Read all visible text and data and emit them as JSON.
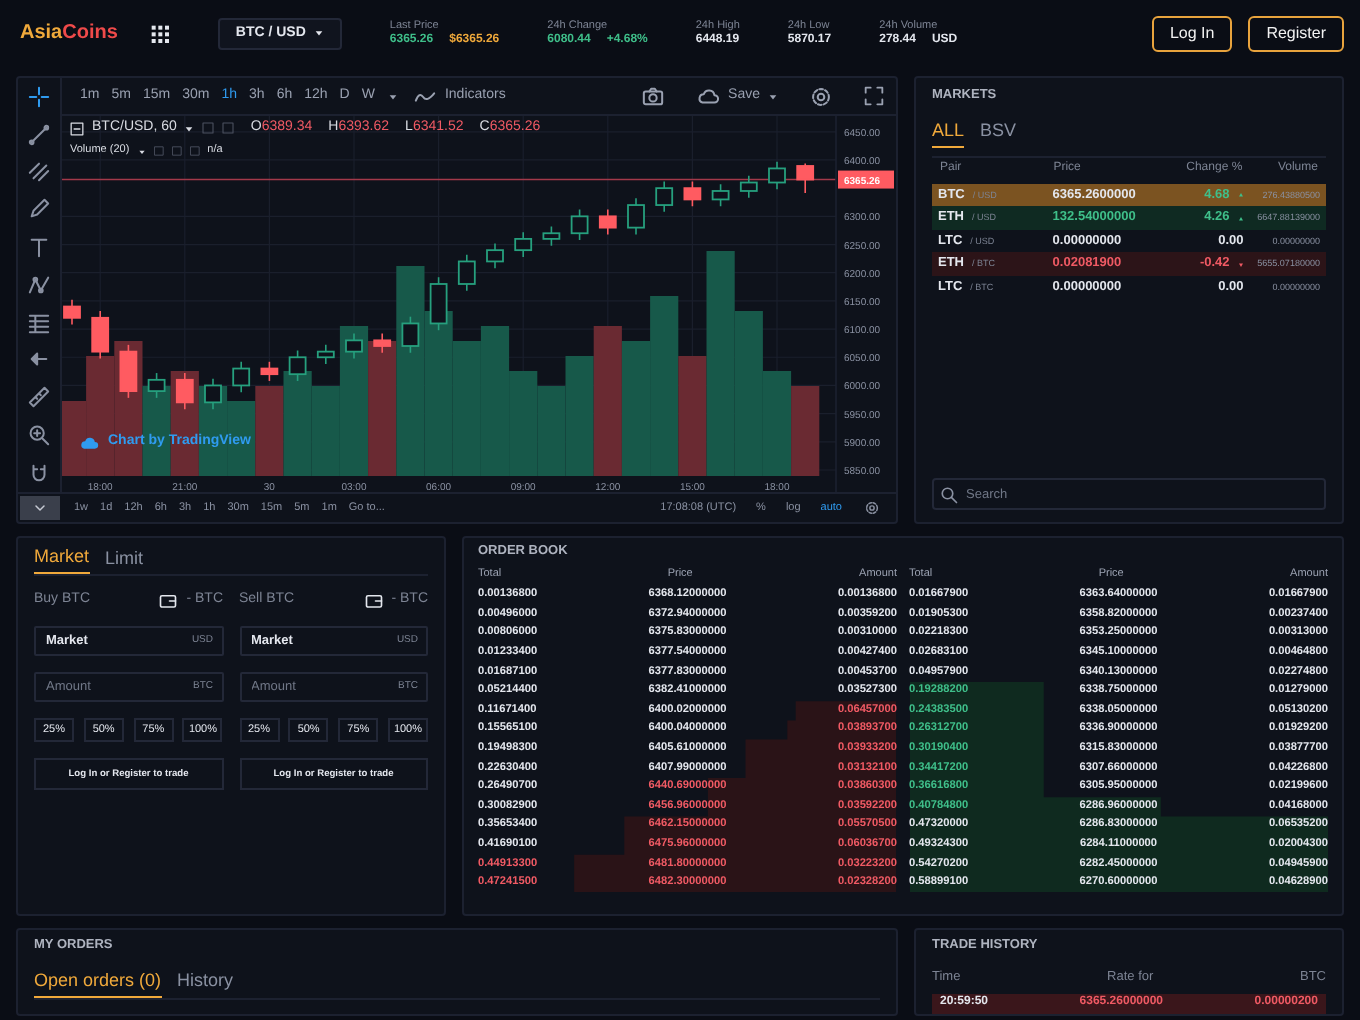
{
  "header": {
    "logo": [
      "Asia",
      "Coins"
    ],
    "pair_selector": "BTC / USD",
    "stats": [
      {
        "label": "Last Price",
        "values": [
          {
            "text": "6365.26",
            "color": "#3fbf8a"
          },
          {
            "text": "$6365.26",
            "color": "#f0a93b"
          }
        ]
      },
      {
        "label": "24h Change",
        "values": [
          {
            "text": "6080.44",
            "color": "#3fbf8a"
          },
          {
            "text": "+4.68%",
            "color": "#3fbf8a"
          }
        ]
      },
      {
        "label": "24h High",
        "values": [
          {
            "text": "6448.19"
          }
        ]
      },
      {
        "label": "24h Low",
        "values": [
          {
            "text": "5870.17"
          }
        ]
      },
      {
        "label": "24h Volume",
        "values": [
          {
            "text": "278.44"
          },
          {
            "text": "USD"
          }
        ]
      }
    ],
    "buttons": [
      "Log In",
      "Register"
    ]
  },
  "chart": {
    "intervals": [
      {
        "label": "1m",
        "selected": false
      },
      {
        "label": "5m",
        "selected": false
      },
      {
        "label": "15m",
        "selected": false
      },
      {
        "label": "30m",
        "selected": false
      },
      {
        "label": "1h",
        "selected": true
      },
      {
        "label": "3h",
        "selected": false
      },
      {
        "label": "6h",
        "selected": false
      },
      {
        "label": "12h",
        "selected": false
      },
      {
        "label": "D",
        "selected": false
      },
      {
        "label": "W",
        "selected": false
      }
    ],
    "indicators": "Indicators",
    "save": "Save",
    "legend": {
      "symbol": "BTC/USD, 60",
      "ohlc": [
        {
          "key": "O",
          "value": "6389.34"
        },
        {
          "key": "H",
          "value": "6393.62"
        },
        {
          "key": "L",
          "value": "6341.52"
        },
        {
          "key": "C",
          "value": "6365.26"
        }
      ],
      "volume": "Volume (20)",
      "volume_value": "n/a"
    },
    "chart_data": {
      "type": "candlestick",
      "categories": [
        null,
        "18:00",
        null,
        null,
        "21:00",
        null,
        null,
        "30",
        null,
        null,
        "03:00",
        null,
        null,
        "06:00",
        null,
        null,
        "09:00",
        null,
        null,
        "12:00",
        null,
        null,
        "15:00",
        null,
        null,
        "18:00",
        null
      ],
      "ohlc": [
        [
          6140,
          6152,
          6108,
          6120
        ],
        [
          6120,
          6132,
          6048,
          6060
        ],
        [
          6060,
          6072,
          5978,
          5990
        ],
        [
          5990,
          6022,
          5978,
          6010
        ],
        [
          6010,
          6022,
          5958,
          5970
        ],
        [
          5970,
          6012,
          5958,
          6000
        ],
        [
          6000,
          6042,
          5988,
          6030
        ],
        [
          6030,
          6042,
          6008,
          6020
        ],
        [
          6020,
          6062,
          6008,
          6050
        ],
        [
          6050,
          6072,
          6038,
          6060
        ],
        [
          6060,
          6092,
          6048,
          6080
        ],
        [
          6080,
          6092,
          6058,
          6070
        ],
        [
          6070,
          6122,
          6058,
          6110
        ],
        [
          6110,
          6192,
          6098,
          6180
        ],
        [
          6180,
          6232,
          6168,
          6220
        ],
        [
          6220,
          6252,
          6208,
          6240
        ],
        [
          6240,
          6272,
          6228,
          6260
        ],
        [
          6260,
          6282,
          6248,
          6270
        ],
        [
          6270,
          6312,
          6258,
          6300
        ],
        [
          6300,
          6312,
          6268,
          6280
        ],
        [
          6280,
          6332,
          6268,
          6320
        ],
        [
          6320,
          6362,
          6308,
          6350
        ],
        [
          6350,
          6362,
          6318,
          6330
        ],
        [
          6330,
          6357,
          6318,
          6345
        ],
        [
          6345,
          6372,
          6333,
          6360
        ],
        [
          6360,
          6397,
          6348,
          6385
        ],
        [
          6389.34,
          6393.62,
          6341.52,
          6365.26
        ]
      ],
      "ylim": [
        5811,
        6478
      ],
      "grid": true,
      "yticks": [
        {
          "value": 6450,
          "label": "6450.00"
        },
        {
          "value": 6400,
          "label": "6400.00"
        },
        {
          "value": 6300,
          "label": "6300.00"
        },
        {
          "value": 6250,
          "label": "6250.00"
        },
        {
          "value": 6200,
          "label": "6200.00"
        },
        {
          "value": 6150,
          "label": "6150.00"
        },
        {
          "value": 6100,
          "label": "6100.00"
        },
        {
          "value": 6050,
          "label": "6050.00"
        },
        {
          "value": 6000,
          "label": "6000.00"
        },
        {
          "value": 5950,
          "label": "5950.00"
        },
        {
          "value": 5900,
          "label": "5900.00"
        },
        {
          "value": 5850,
          "label": "5850.00"
        }
      ]
    },
    "price_tag": "6365.26",
    "attribution": "Chart by TradingView",
    "ranges": [
      "1w",
      "1d",
      "12h",
      "6h",
      "3h",
      "1h",
      "30m",
      "15m",
      "5m",
      "1m"
    ],
    "goto": "Go to...",
    "clock": "17:08:08 (UTC)",
    "scale_options": [
      {
        "label": "%",
        "selected": false
      },
      {
        "label": "log",
        "selected": false
      },
      {
        "label": "auto",
        "selected": true
      }
    ]
  },
  "markets": {
    "title": "MARKETS",
    "tabs": [
      {
        "label": "ALL",
        "selected": true
      },
      {
        "label": "BSV",
        "selected": false
      }
    ],
    "columns": [
      "Pair",
      "Price",
      "Change %",
      "Volume"
    ],
    "rows": [
      {
        "base": "BTC",
        "quote": "/ USD",
        "price": "6365.2600000",
        "change": "4.68",
        "volume": "276.43880500",
        "kind": "up",
        "selected": true
      },
      {
        "base": "ETH",
        "quote": "/ USD",
        "price": "132.54000000",
        "change": "4.26",
        "volume": "6647.88139000",
        "kind": "up",
        "selected": false
      },
      {
        "base": "LTC",
        "quote": "/ USD",
        "price": "0.00000000",
        "change": "0.00",
        "volume": "0.00000000",
        "kind": "flat",
        "selected": false
      },
      {
        "base": "ETH",
        "quote": "/ BTC",
        "price": "0.02081900",
        "change": "-0.42",
        "volume": "5655.07180000",
        "kind": "down",
        "selected": false
      },
      {
        "base": "LTC",
        "quote": "/ BTC",
        "price": "0.00000000",
        "change": "0.00",
        "volume": "0.00000000",
        "kind": "flat",
        "selected": false
      }
    ],
    "search": {
      "placeholder": "Search"
    }
  },
  "order_form": {
    "tabs": [
      {
        "label": "Market",
        "selected": true
      },
      {
        "label": "Limit",
        "selected": false
      }
    ],
    "sides": [
      {
        "title": "Buy BTC",
        "balance": "- BTC",
        "price_field": {
          "value": "Market",
          "unit": "USD"
        },
        "amount_field": {
          "placeholder": "Amount",
          "unit": "BTC"
        },
        "percents": [
          "25%",
          "50%",
          "75%",
          "100%"
        ],
        "login_note": {
          "link_1": "Log In",
          "middle": "or",
          "link_2": "Register",
          "end": "to trade"
        }
      },
      {
        "title": "Sell BTC",
        "balance": "- BTC",
        "price_field": {
          "value": "Market",
          "unit": "USD"
        },
        "amount_field": {
          "placeholder": "Amount",
          "unit": "BTC"
        },
        "percents": [
          "25%",
          "50%",
          "75%",
          "100%"
        ],
        "login_note": {
          "link_1": "Log In",
          "middle": "or",
          "link_2": "Register",
          "end": "to trade"
        }
      }
    ]
  },
  "order_book": {
    "title": "ORDER BOOK",
    "sides": [
      {
        "kind": "ask",
        "columns": [
          "Total",
          "Price",
          "Amount"
        ],
        "rows": [
          {
            "total": "0.00136800",
            "price": "6368.12000000",
            "amount": "0.00136800",
            "colored": [
              false,
              false,
              false
            ]
          },
          {
            "total": "0.00496000",
            "price": "6372.94000000",
            "amount": "0.00359200",
            "colored": [
              false,
              false,
              false
            ]
          },
          {
            "total": "0.00806000",
            "price": "6375.83000000",
            "amount": "0.00310000",
            "colored": [
              false,
              false,
              false
            ]
          },
          {
            "total": "0.01233400",
            "price": "6377.54000000",
            "amount": "0.00427400",
            "colored": [
              false,
              false,
              false
            ]
          },
          {
            "total": "0.01687100",
            "price": "6377.83000000",
            "amount": "0.00453700",
            "colored": [
              false,
              false,
              false
            ]
          },
          {
            "total": "0.05214400",
            "price": "6382.41000000",
            "amount": "0.03527300",
            "colored": [
              false,
              false,
              false
            ]
          },
          {
            "total": "0.11671400",
            "price": "6400.02000000",
            "amount": "0.06457000",
            "colored": [
              false,
              false,
              true
            ]
          },
          {
            "total": "0.15565100",
            "price": "6400.04000000",
            "amount": "0.03893700",
            "colored": [
              false,
              false,
              true
            ]
          },
          {
            "total": "0.19498300",
            "price": "6405.61000000",
            "amount": "0.03933200",
            "colored": [
              false,
              false,
              true
            ]
          },
          {
            "total": "0.22630400",
            "price": "6407.99000000",
            "amount": "0.03132100",
            "colored": [
              false,
              false,
              true
            ]
          },
          {
            "total": "0.26490700",
            "price": "6440.69000000",
            "amount": "0.03860300",
            "colored": [
              false,
              true,
              true
            ]
          },
          {
            "total": "0.30082900",
            "price": "6456.96000000",
            "amount": "0.03592200",
            "colored": [
              false,
              true,
              true
            ]
          },
          {
            "total": "0.35653400",
            "price": "6462.15000000",
            "amount": "0.05570500",
            "colored": [
              false,
              true,
              true
            ]
          },
          {
            "total": "0.41690100",
            "price": "6475.96000000",
            "amount": "0.06036700",
            "colored": [
              false,
              true,
              true
            ]
          },
          {
            "total": "0.44913300",
            "price": "6481.80000000",
            "amount": "0.03223200",
            "colored": [
              true,
              true,
              true
            ]
          },
          {
            "total": "0.47241500",
            "price": "6482.30000000",
            "amount": "0.02328200",
            "colored": [
              true,
              true,
              true
            ]
          }
        ]
      },
      {
        "kind": "bid",
        "columns": [
          "Total",
          "Price",
          "Amount"
        ],
        "rows": [
          {
            "total": "0.01667900",
            "price": "6363.64000000",
            "amount": "0.01667900",
            "colored": [
              false,
              false,
              false
            ]
          },
          {
            "total": "0.01905300",
            "price": "6358.82000000",
            "amount": "0.00237400",
            "colored": [
              false,
              false,
              false
            ]
          },
          {
            "total": "0.02218300",
            "price": "6353.25000000",
            "amount": "0.00313000",
            "colored": [
              false,
              false,
              false
            ]
          },
          {
            "total": "0.02683100",
            "price": "6345.10000000",
            "amount": "0.00464800",
            "colored": [
              false,
              false,
              false
            ]
          },
          {
            "total": "0.04957900",
            "price": "6340.13000000",
            "amount": "0.02274800",
            "colored": [
              false,
              false,
              false
            ]
          },
          {
            "total": "0.19288200",
            "price": "6338.75000000",
            "amount": "0.01279000",
            "colored": [
              true,
              false,
              false
            ]
          },
          {
            "total": "0.24383500",
            "price": "6338.05000000",
            "amount": "0.05130200",
            "colored": [
              true,
              false,
              false
            ]
          },
          {
            "total": "0.26312700",
            "price": "6336.90000000",
            "amount": "0.01929200",
            "colored": [
              true,
              false,
              false
            ]
          },
          {
            "total": "0.30190400",
            "price": "6315.83000000",
            "amount": "0.03877700",
            "colored": [
              true,
              false,
              false
            ]
          },
          {
            "total": "0.34417200",
            "price": "6307.66000000",
            "amount": "0.04226800",
            "colored": [
              true,
              false,
              false
            ]
          },
          {
            "total": "0.36616800",
            "price": "6305.95000000",
            "amount": "0.02199600",
            "colored": [
              true,
              false,
              false
            ]
          },
          {
            "total": "0.40784800",
            "price": "6286.96000000",
            "amount": "0.04168000",
            "colored": [
              true,
              false,
              false
            ]
          },
          {
            "total": "0.47320000",
            "price": "6286.83000000",
            "amount": "0.06535200",
            "colored": [
              false,
              false,
              false
            ]
          },
          {
            "total": "0.49324300",
            "price": "6284.11000000",
            "amount": "0.02004300",
            "colored": [
              false,
              false,
              false
            ]
          },
          {
            "total": "0.54270200",
            "price": "6282.45000000",
            "amount": "0.04945900",
            "colored": [
              false,
              false,
              false
            ]
          },
          {
            "total": "0.58899100",
            "price": "6270.60000000",
            "amount": "0.04628900",
            "colored": [
              false,
              false,
              false
            ]
          }
        ]
      }
    ]
  },
  "my_orders": {
    "title": "MY ORDERS",
    "tabs": [
      {
        "label": "Open orders (0)",
        "selected": true
      },
      {
        "label": "History",
        "selected": false
      }
    ]
  },
  "trade_history": {
    "title": "TRADE HISTORY",
    "columns": [
      "Time",
      "Rate for",
      "BTC"
    ],
    "rows": [
      {
        "time": "20:59:50",
        "rate": "6365.26000000",
        "amount": "0.00000200",
        "kind": "sell"
      }
    ]
  }
}
